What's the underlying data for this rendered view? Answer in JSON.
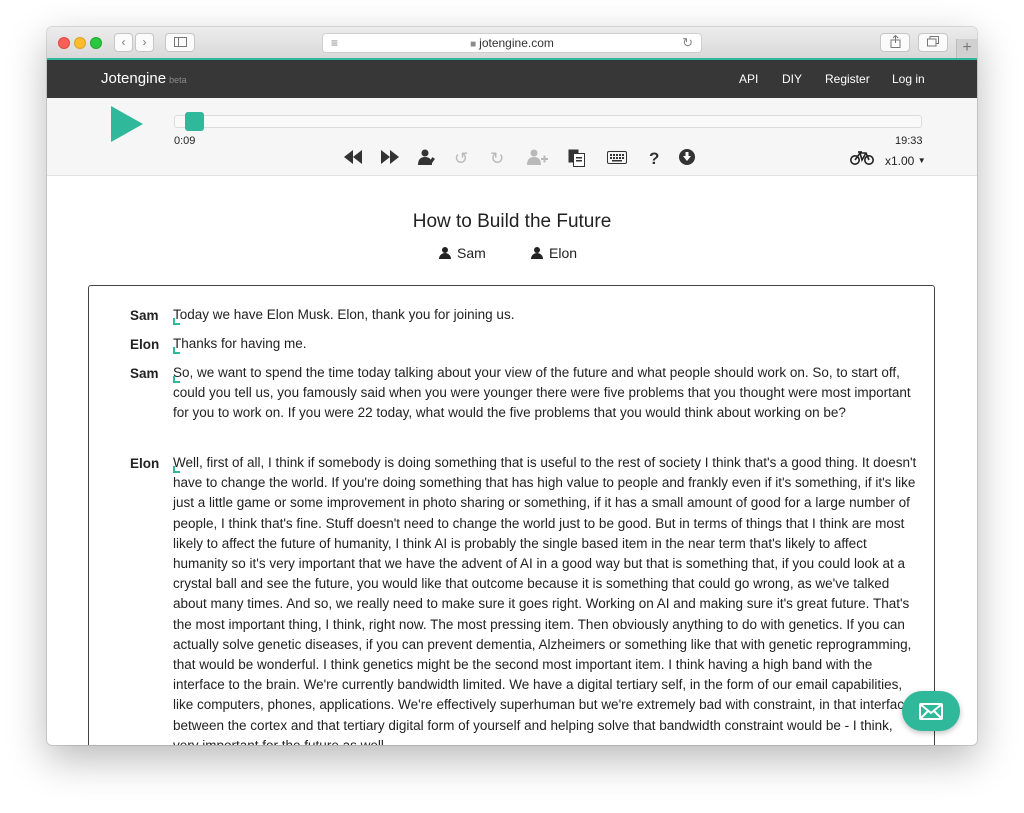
{
  "browser": {
    "url": "jotengine.com"
  },
  "navbar": {
    "brand": "Jotengine",
    "badge": "beta",
    "links": [
      "API",
      "DIY",
      "Register",
      "Log in"
    ]
  },
  "player": {
    "progress": 0.0077,
    "current_time": "0:09",
    "duration": "19:33",
    "speed": "x1.00",
    "controls": [
      "rewind-icon",
      "fast-forward-icon",
      "speakers-icon",
      "undo-icon",
      "redo-icon",
      "add-speaker-icon",
      "copy-icon",
      "keyboard-icon",
      "help-icon",
      "download-icon"
    ]
  },
  "document": {
    "title": "How to Build the Future",
    "speakers": [
      "Sam",
      "Elon"
    ]
  },
  "transcript": [
    {
      "speaker": "Sam",
      "text": "Today we have Elon Musk. Elon, thank you for joining us."
    },
    {
      "speaker": "Elon",
      "text": "Thanks for having me."
    },
    {
      "speaker": "Sam",
      "text": "So, we want to spend the time today talking about your view of the future and what people should work on. So, to start off, could you tell us, you famously said when you were younger there were five problems that you thought were most important for you to work on. If you were 22 today, what would the five problems that you would think about working on be?"
    },
    {
      "speaker": "Elon",
      "text": "Well, first of all, I think if somebody is doing something that is useful to the rest of society I think that's a good thing. It doesn't have to change the world. If you're doing something that has high value to people and frankly even if it's something, if it's like just a little game or some improvement in photo sharing or something, if it has a small amount of good for a large number of people, I think that's fine. Stuff doesn't need to change the world just to be good. But in terms of things that I think are most likely to affect the future of humanity, I think AI is probably the single based item in the near term that's likely to affect humanity so it's very important that we have the advent of AI in a good way but that is something that, if you could look at a crystal ball and see the future, you would like that outcome because it is something that could go wrong, as we've talked about many times. And so, we really need to make sure it goes right. Working on AI and making sure it's great future. That's the most important thing, I think, right now. The most pressing item. Then obviously anything to do with genetics. If you can actually solve genetic diseases, if you can prevent dementia, Alzheimers or something like that with genetic reprogramming, that would be wonderful. I think genetics might be the second most important item. I think having a high band with the interface to the brain. We're currently bandwidth limited. We have a digital tertiary self, in the form of our email capabilities, like computers, phones, applications. We're effectively superhuman but we're extremely bad with constraint, in that interface between the cortex and that tertiary digital form of yourself and helping solve that bandwidth constraint would be - I think, very important for the future as well."
    }
  ]
}
